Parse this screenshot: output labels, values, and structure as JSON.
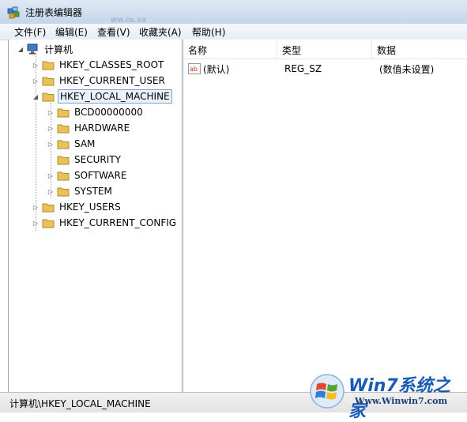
{
  "window": {
    "title": "注册表编辑器",
    "background_hint": "ww.ox.xx"
  },
  "menu": [
    "文件(F)",
    "编辑(E)",
    "查看(V)",
    "收藏夹(A)",
    "帮助(H)"
  ],
  "tree": {
    "root": "计算机",
    "hives": [
      {
        "label": "HKEY_CLASSES_ROOT",
        "expanded": false
      },
      {
        "label": "HKEY_CURRENT_USER",
        "expanded": false
      },
      {
        "label": "HKEY_LOCAL_MACHINE",
        "expanded": true,
        "selected": true
      },
      {
        "label": "HKEY_USERS",
        "expanded": false
      },
      {
        "label": "HKEY_CURRENT_CONFIG",
        "expanded": false
      }
    ],
    "hklm_children": [
      "BCD00000000",
      "HARDWARE",
      "SAM",
      "SECURITY",
      "SOFTWARE",
      "SYSTEM"
    ]
  },
  "list": {
    "columns": [
      "名称",
      "类型",
      "数据"
    ],
    "rows": [
      {
        "name": "(默认)",
        "type": "REG_SZ",
        "data": "(数值未设置)",
        "icon": "string-value-icon"
      }
    ]
  },
  "status": {
    "path": "计算机\\HKEY_LOCAL_MACHINE"
  },
  "watermark": {
    "brand": "Win7系统之家",
    "url": "Www.Winwin7.com"
  },
  "colors": {
    "folder": "#e8c15a",
    "selection_border": "#7da2ce",
    "brand_blue": "#1a5bb5"
  }
}
